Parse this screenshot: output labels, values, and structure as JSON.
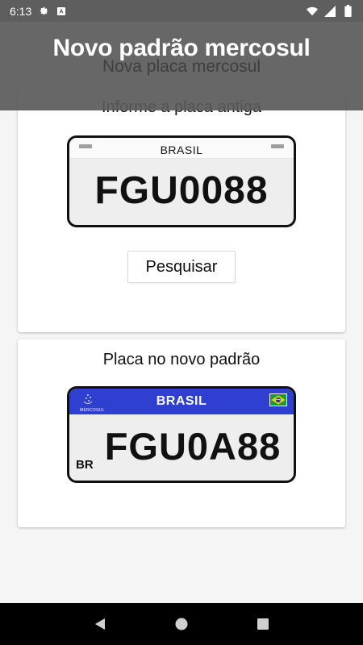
{
  "status_bar": {
    "time": "6:13",
    "icons": [
      "gear-icon",
      "a-icon",
      "wifi-icon",
      "signal-icon",
      "battery-icon"
    ]
  },
  "app_bar": {
    "title": "Novo padrão mercosul",
    "subtitle_under": "Nova placa mercosul"
  },
  "old_plate_card": {
    "title": "Informe a placa antiga",
    "plate_country": "BRASIL",
    "plate_number": "FGU0088",
    "search_button": "Pesquisar"
  },
  "new_plate_card": {
    "title": "Placa no novo padrão",
    "plate_country": "BRASIL",
    "plate_number": "FGU0A88",
    "country_code": "BR",
    "mercosul_label": "MERCOSUL"
  },
  "nav_bar": {
    "buttons": [
      "back-icon",
      "home-icon",
      "recents-icon"
    ]
  },
  "colors": {
    "app_bar": "#5a5a5a",
    "mercosul_blue": "#2f3fd0",
    "flag_green": "#1a9a3a",
    "flag_yellow": "#f2d600",
    "flag_blue": "#1f3f8a"
  }
}
